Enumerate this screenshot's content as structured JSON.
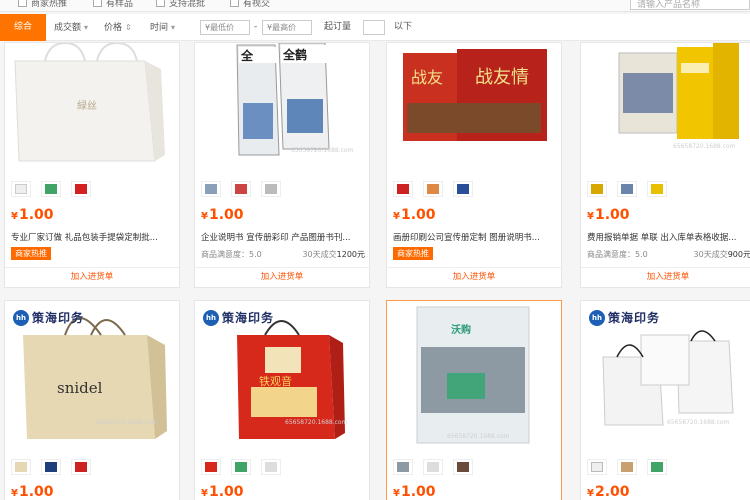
{
  "filters": {
    "checkboxes": [
      "商家热推",
      "有样品",
      "支持混批",
      "有视交"
    ],
    "search_placeholder": "请输入产品名称"
  },
  "sort": {
    "tabs": [
      {
        "label": "综合",
        "active": true
      },
      {
        "label": "成交额"
      },
      {
        "label": "价格"
      },
      {
        "label": "时间"
      }
    ],
    "price_min_placeholder": "¥最低价",
    "price_sep": "-",
    "price_max_placeholder": "¥最高价",
    "moq_label": "起订量",
    "moq_suffix": "以下"
  },
  "products": [
    {
      "price_symbol": "¥",
      "price": "1.00",
      "title": "专业厂家订做 礼品包装手提袋定制批...",
      "badge": "商家热推",
      "add_label": "加入进货单"
    },
    {
      "price_symbol": "¥",
      "price": "1.00",
      "title": "企业说明书 宣传册彩印 产品图册书刊...",
      "satisfaction_label": "商品满意度：",
      "satisfaction": "5.0",
      "deals_label": "30天成交",
      "deals": "1200元",
      "watermark": "65658720.1688.com",
      "add_label": "加入进货单"
    },
    {
      "price_symbol": "¥",
      "price": "1.00",
      "title": "画册印刷公司宣传册定制 图册说明书...",
      "badge": "商家热推",
      "add_label": "加入进货单"
    },
    {
      "price_symbol": "¥",
      "price": "1.00",
      "title": "费用报销单据 单联 出入库单表格收据...",
      "satisfaction_label": "商品满意度：",
      "satisfaction": "5.0",
      "deals_label": "30天成交",
      "deals": "900元",
      "watermark": "65658720.1688.com",
      "add_label": "加入进货单"
    },
    {
      "price_symbol": "¥",
      "price": "1.00",
      "brand": "策海印务",
      "brand_mark": "hh",
      "watermark": "65658720.1688.com",
      "bag_text": "snidel"
    },
    {
      "price_symbol": "¥",
      "price": "1.00",
      "brand": "策海印务",
      "brand_mark": "hh",
      "watermark": "65658720.1688.com"
    },
    {
      "price_symbol": "¥",
      "price": "1.00",
      "logo_text": "沃购",
      "watermark": "65658720.1688.com"
    },
    {
      "price_symbol": "¥",
      "price": "2.00",
      "brand": "策海印务",
      "brand_mark": "hh",
      "watermark": "65658720.1688.com"
    }
  ],
  "colors": {
    "accent": "#ff7300",
    "price": "#ff5000",
    "badge": "#ff6a00"
  }
}
